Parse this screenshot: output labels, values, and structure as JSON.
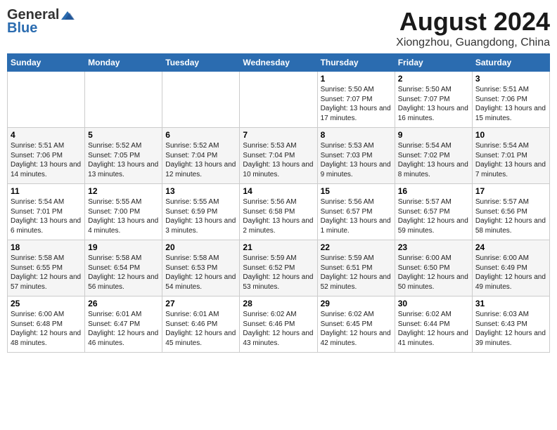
{
  "header": {
    "logo_general": "General",
    "logo_blue": "Blue",
    "main_title": "August 2024",
    "subtitle": "Xiongzhou, Guangdong, China"
  },
  "weekdays": [
    "Sunday",
    "Monday",
    "Tuesday",
    "Wednesday",
    "Thursday",
    "Friday",
    "Saturday"
  ],
  "weeks": [
    [
      {
        "day": "",
        "info": ""
      },
      {
        "day": "",
        "info": ""
      },
      {
        "day": "",
        "info": ""
      },
      {
        "day": "",
        "info": ""
      },
      {
        "day": "1",
        "info": "Sunrise: 5:50 AM\nSunset: 7:07 PM\nDaylight: 13 hours and 17 minutes."
      },
      {
        "day": "2",
        "info": "Sunrise: 5:50 AM\nSunset: 7:07 PM\nDaylight: 13 hours and 16 minutes."
      },
      {
        "day": "3",
        "info": "Sunrise: 5:51 AM\nSunset: 7:06 PM\nDaylight: 13 hours and 15 minutes."
      }
    ],
    [
      {
        "day": "4",
        "info": "Sunrise: 5:51 AM\nSunset: 7:06 PM\nDaylight: 13 hours and 14 minutes."
      },
      {
        "day": "5",
        "info": "Sunrise: 5:52 AM\nSunset: 7:05 PM\nDaylight: 13 hours and 13 minutes."
      },
      {
        "day": "6",
        "info": "Sunrise: 5:52 AM\nSunset: 7:04 PM\nDaylight: 13 hours and 12 minutes."
      },
      {
        "day": "7",
        "info": "Sunrise: 5:53 AM\nSunset: 7:04 PM\nDaylight: 13 hours and 10 minutes."
      },
      {
        "day": "8",
        "info": "Sunrise: 5:53 AM\nSunset: 7:03 PM\nDaylight: 13 hours and 9 minutes."
      },
      {
        "day": "9",
        "info": "Sunrise: 5:54 AM\nSunset: 7:02 PM\nDaylight: 13 hours and 8 minutes."
      },
      {
        "day": "10",
        "info": "Sunrise: 5:54 AM\nSunset: 7:01 PM\nDaylight: 13 hours and 7 minutes."
      }
    ],
    [
      {
        "day": "11",
        "info": "Sunrise: 5:54 AM\nSunset: 7:01 PM\nDaylight: 13 hours and 6 minutes."
      },
      {
        "day": "12",
        "info": "Sunrise: 5:55 AM\nSunset: 7:00 PM\nDaylight: 13 hours and 4 minutes."
      },
      {
        "day": "13",
        "info": "Sunrise: 5:55 AM\nSunset: 6:59 PM\nDaylight: 13 hours and 3 minutes."
      },
      {
        "day": "14",
        "info": "Sunrise: 5:56 AM\nSunset: 6:58 PM\nDaylight: 13 hours and 2 minutes."
      },
      {
        "day": "15",
        "info": "Sunrise: 5:56 AM\nSunset: 6:57 PM\nDaylight: 13 hours and 1 minute."
      },
      {
        "day": "16",
        "info": "Sunrise: 5:57 AM\nSunset: 6:57 PM\nDaylight: 12 hours and 59 minutes."
      },
      {
        "day": "17",
        "info": "Sunrise: 5:57 AM\nSunset: 6:56 PM\nDaylight: 12 hours and 58 minutes."
      }
    ],
    [
      {
        "day": "18",
        "info": "Sunrise: 5:58 AM\nSunset: 6:55 PM\nDaylight: 12 hours and 57 minutes."
      },
      {
        "day": "19",
        "info": "Sunrise: 5:58 AM\nSunset: 6:54 PM\nDaylight: 12 hours and 56 minutes."
      },
      {
        "day": "20",
        "info": "Sunrise: 5:58 AM\nSunset: 6:53 PM\nDaylight: 12 hours and 54 minutes."
      },
      {
        "day": "21",
        "info": "Sunrise: 5:59 AM\nSunset: 6:52 PM\nDaylight: 12 hours and 53 minutes."
      },
      {
        "day": "22",
        "info": "Sunrise: 5:59 AM\nSunset: 6:51 PM\nDaylight: 12 hours and 52 minutes."
      },
      {
        "day": "23",
        "info": "Sunrise: 6:00 AM\nSunset: 6:50 PM\nDaylight: 12 hours and 50 minutes."
      },
      {
        "day": "24",
        "info": "Sunrise: 6:00 AM\nSunset: 6:49 PM\nDaylight: 12 hours and 49 minutes."
      }
    ],
    [
      {
        "day": "25",
        "info": "Sunrise: 6:00 AM\nSunset: 6:48 PM\nDaylight: 12 hours and 48 minutes."
      },
      {
        "day": "26",
        "info": "Sunrise: 6:01 AM\nSunset: 6:47 PM\nDaylight: 12 hours and 46 minutes."
      },
      {
        "day": "27",
        "info": "Sunrise: 6:01 AM\nSunset: 6:46 PM\nDaylight: 12 hours and 45 minutes."
      },
      {
        "day": "28",
        "info": "Sunrise: 6:02 AM\nSunset: 6:46 PM\nDaylight: 12 hours and 43 minutes."
      },
      {
        "day": "29",
        "info": "Sunrise: 6:02 AM\nSunset: 6:45 PM\nDaylight: 12 hours and 42 minutes."
      },
      {
        "day": "30",
        "info": "Sunrise: 6:02 AM\nSunset: 6:44 PM\nDaylight: 12 hours and 41 minutes."
      },
      {
        "day": "31",
        "info": "Sunrise: 6:03 AM\nSunset: 6:43 PM\nDaylight: 12 hours and 39 minutes."
      }
    ]
  ]
}
